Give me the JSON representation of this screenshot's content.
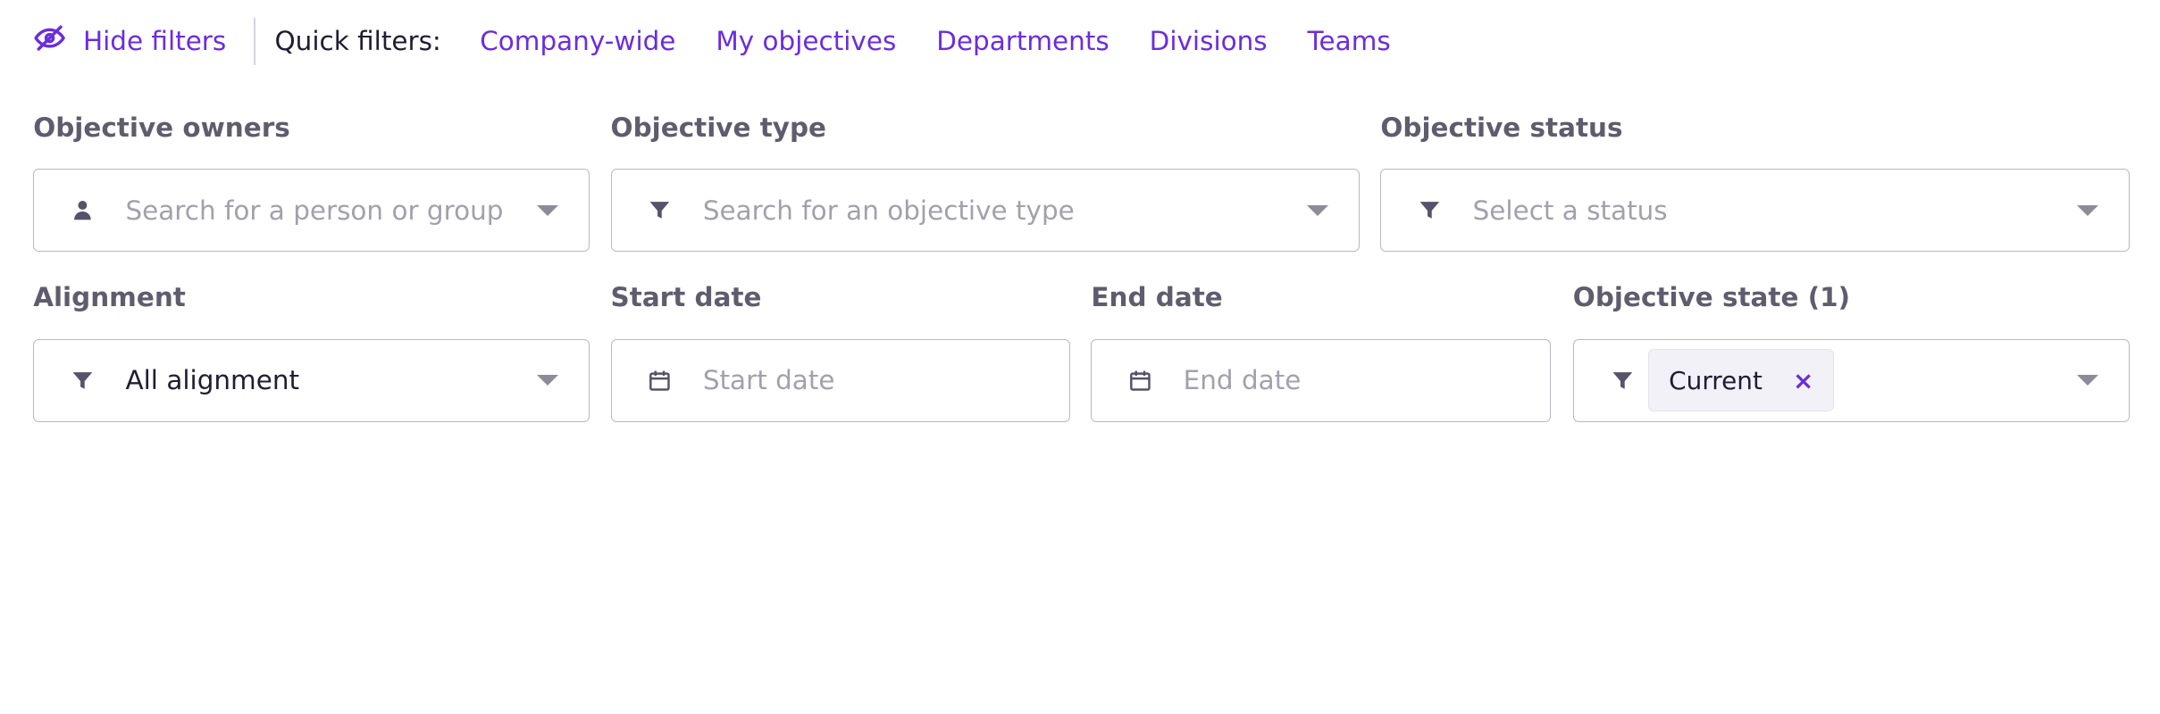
{
  "topbar": {
    "hide_filters_label": "Hide filters",
    "hide_filters_icon": "eye-slash-icon",
    "quick_filters_label": "Quick filters:",
    "quick_filters": [
      "Company-wide",
      "My objectives",
      "Departments",
      "Divisions",
      "Teams"
    ]
  },
  "filters": {
    "owners": {
      "label": "Objective owners",
      "placeholder": "Search for a person or group",
      "icon": "person-icon"
    },
    "type": {
      "label": "Objective type",
      "placeholder": "Search for an objective type",
      "icon": "filter-icon"
    },
    "status": {
      "label": "Objective status",
      "placeholder": "Select a status",
      "icon": "filter-icon"
    },
    "alignment": {
      "label": "Alignment",
      "value": "All alignment",
      "icon": "filter-icon"
    },
    "start_date": {
      "label": "Start date",
      "placeholder": "Start date",
      "icon": "calendar-icon"
    },
    "end_date": {
      "label": "End date",
      "placeholder": "End date",
      "icon": "calendar-icon"
    },
    "state": {
      "label": "Objective state (1)",
      "chip": "Current",
      "chip_remove": "×",
      "icon": "filter-icon"
    }
  },
  "colors": {
    "accent": "#6b2ce0",
    "label": "#5f5c6e",
    "border": "#b9b7c2",
    "placeholder": "#a3a0ad"
  }
}
